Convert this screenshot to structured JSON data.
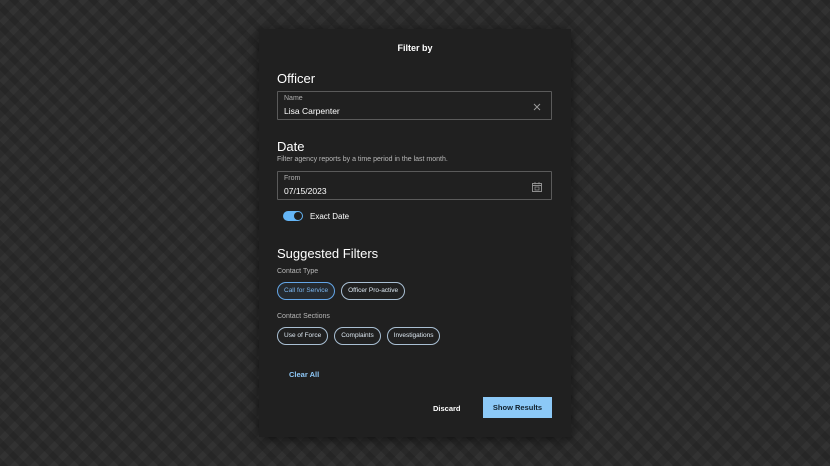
{
  "dialog": {
    "title": "Filter by"
  },
  "officer": {
    "heading": "Officer",
    "name_field": {
      "label": "Name",
      "value": "Lisa Carpenter",
      "clear_icon": "close-icon"
    }
  },
  "date": {
    "heading": "Date",
    "description": "Filter agency reports by a time period in the last month.",
    "from_field": {
      "label": "From",
      "value": "07/15/2023",
      "icon": "calendar-icon"
    },
    "exact_date": {
      "label": "Exact Date",
      "enabled": true
    }
  },
  "suggested": {
    "heading": "Suggested Filters",
    "contact_type": {
      "label": "Contact Type",
      "chips": [
        {
          "label": "Call for Service",
          "selected": true
        },
        {
          "label": "Officer Pro-active",
          "selected": false
        }
      ]
    },
    "contact_sections": {
      "label": "Contact Sections",
      "chips": [
        {
          "label": "Use of Force",
          "selected": false
        },
        {
          "label": "Complaints",
          "selected": false
        },
        {
          "label": "Investigations",
          "selected": false
        }
      ]
    }
  },
  "actions": {
    "clear_all": "Clear All",
    "discard": "Discard",
    "show_results": "Show Results"
  },
  "colors": {
    "accent": "#64b5f6",
    "primary_button": "#8cc9f7",
    "panel": "#202020"
  }
}
